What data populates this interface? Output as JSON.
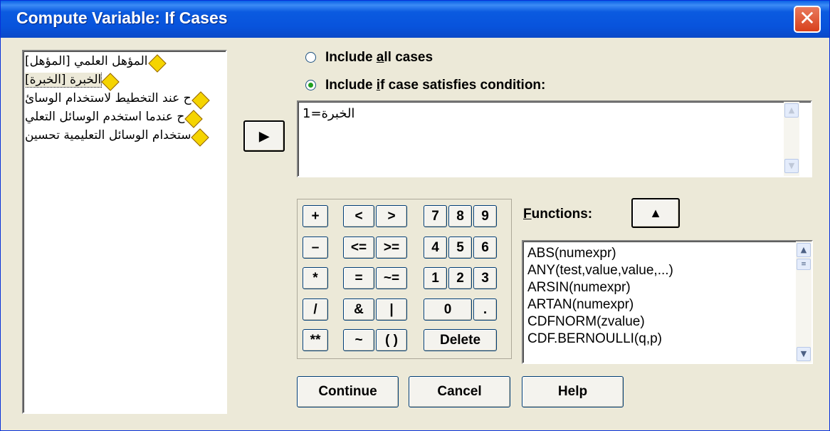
{
  "window": {
    "title": "Compute Variable: If Cases",
    "close_glyph": "✕"
  },
  "variables": [
    "المؤهل العلمي [المؤهل]",
    "الخبرة [الخبرة]",
    "ح عند التخطيط لاستخدام الوسائ",
    "ح عندما استخدم الوسائل التعلي",
    "ستخدام الوسائل التعليمية تحسين"
  ],
  "transfer_button": {
    "glyph": "▶"
  },
  "radios": {
    "all": {
      "pre": "Include ",
      "underline": "a",
      "post": "ll cases",
      "selected": false
    },
    "if": {
      "pre": "Include ",
      "underline": "i",
      "post": "f case satisfies condition:",
      "selected": true
    }
  },
  "condition": {
    "value": "الخبرة=1"
  },
  "calculator": {
    "plus": "+",
    "lt": "<",
    "gt": ">",
    "n7": "7",
    "n8": "8",
    "n9": "9",
    "minus": "–",
    "le": "<=",
    "ge": ">=",
    "n4": "4",
    "n5": "5",
    "n6": "6",
    "mult": "*",
    "eq": "=",
    "ne": "~=",
    "n1": "1",
    "n2": "2",
    "n3": "3",
    "div": "/",
    "and": "&",
    "or": "|",
    "n0": "0",
    "dot": ".",
    "pow": "**",
    "not": "~",
    "paren": "( )",
    "delete": "Delete"
  },
  "functions": {
    "label_underline": "F",
    "label_rest": "unctions:",
    "up_glyph": "▲",
    "items": [
      "ABS(numexpr)",
      "ANY(test,value,value,...)",
      "ARSIN(numexpr)",
      "ARTAN(numexpr)",
      "CDFNORM(zvalue)",
      "CDF.BERNOULLI(q,p)"
    ]
  },
  "buttons": {
    "continue": "Continue",
    "cancel": "Cancel",
    "help": "Help"
  },
  "colors": {
    "titlebar": "#0853dc",
    "dialog_bg": "#ece9d8",
    "close": "#d8401b",
    "radio_dot": "#20a020"
  }
}
